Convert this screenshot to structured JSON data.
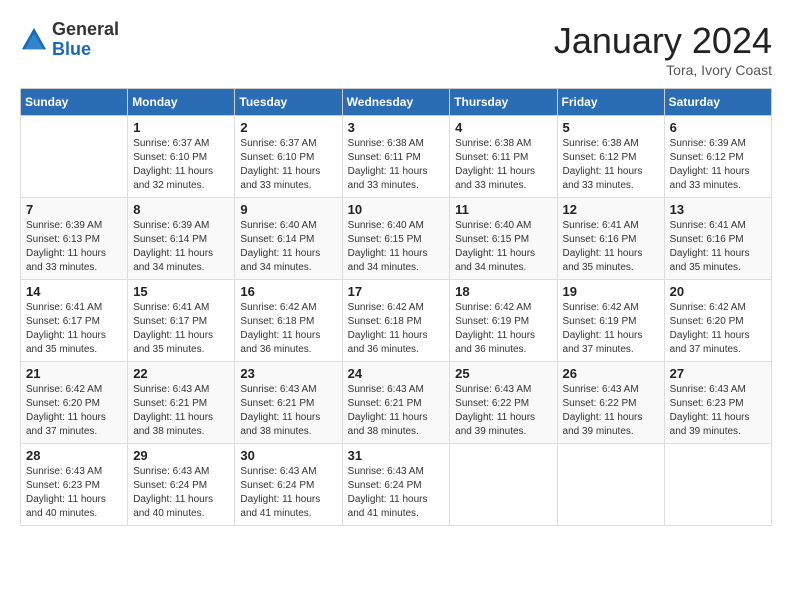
{
  "logo": {
    "general": "General",
    "blue": "Blue"
  },
  "title": "January 2024",
  "subtitle": "Tora, Ivory Coast",
  "days_header": [
    "Sunday",
    "Monday",
    "Tuesday",
    "Wednesday",
    "Thursday",
    "Friday",
    "Saturday"
  ],
  "weeks": [
    [
      {
        "day": "",
        "sunrise": "",
        "sunset": "",
        "daylight": ""
      },
      {
        "day": "1",
        "sunrise": "Sunrise: 6:37 AM",
        "sunset": "Sunset: 6:10 PM",
        "daylight": "Daylight: 11 hours and 32 minutes."
      },
      {
        "day": "2",
        "sunrise": "Sunrise: 6:37 AM",
        "sunset": "Sunset: 6:10 PM",
        "daylight": "Daylight: 11 hours and 33 minutes."
      },
      {
        "day": "3",
        "sunrise": "Sunrise: 6:38 AM",
        "sunset": "Sunset: 6:11 PM",
        "daylight": "Daylight: 11 hours and 33 minutes."
      },
      {
        "day": "4",
        "sunrise": "Sunrise: 6:38 AM",
        "sunset": "Sunset: 6:11 PM",
        "daylight": "Daylight: 11 hours and 33 minutes."
      },
      {
        "day": "5",
        "sunrise": "Sunrise: 6:38 AM",
        "sunset": "Sunset: 6:12 PM",
        "daylight": "Daylight: 11 hours and 33 minutes."
      },
      {
        "day": "6",
        "sunrise": "Sunrise: 6:39 AM",
        "sunset": "Sunset: 6:12 PM",
        "daylight": "Daylight: 11 hours and 33 minutes."
      }
    ],
    [
      {
        "day": "7",
        "sunrise": "Sunrise: 6:39 AM",
        "sunset": "Sunset: 6:13 PM",
        "daylight": "Daylight: 11 hours and 33 minutes."
      },
      {
        "day": "8",
        "sunrise": "Sunrise: 6:39 AM",
        "sunset": "Sunset: 6:14 PM",
        "daylight": "Daylight: 11 hours and 34 minutes."
      },
      {
        "day": "9",
        "sunrise": "Sunrise: 6:40 AM",
        "sunset": "Sunset: 6:14 PM",
        "daylight": "Daylight: 11 hours and 34 minutes."
      },
      {
        "day": "10",
        "sunrise": "Sunrise: 6:40 AM",
        "sunset": "Sunset: 6:15 PM",
        "daylight": "Daylight: 11 hours and 34 minutes."
      },
      {
        "day": "11",
        "sunrise": "Sunrise: 6:40 AM",
        "sunset": "Sunset: 6:15 PM",
        "daylight": "Daylight: 11 hours and 34 minutes."
      },
      {
        "day": "12",
        "sunrise": "Sunrise: 6:41 AM",
        "sunset": "Sunset: 6:16 PM",
        "daylight": "Daylight: 11 hours and 35 minutes."
      },
      {
        "day": "13",
        "sunrise": "Sunrise: 6:41 AM",
        "sunset": "Sunset: 6:16 PM",
        "daylight": "Daylight: 11 hours and 35 minutes."
      }
    ],
    [
      {
        "day": "14",
        "sunrise": "Sunrise: 6:41 AM",
        "sunset": "Sunset: 6:17 PM",
        "daylight": "Daylight: 11 hours and 35 minutes."
      },
      {
        "day": "15",
        "sunrise": "Sunrise: 6:41 AM",
        "sunset": "Sunset: 6:17 PM",
        "daylight": "Daylight: 11 hours and 35 minutes."
      },
      {
        "day": "16",
        "sunrise": "Sunrise: 6:42 AM",
        "sunset": "Sunset: 6:18 PM",
        "daylight": "Daylight: 11 hours and 36 minutes."
      },
      {
        "day": "17",
        "sunrise": "Sunrise: 6:42 AM",
        "sunset": "Sunset: 6:18 PM",
        "daylight": "Daylight: 11 hours and 36 minutes."
      },
      {
        "day": "18",
        "sunrise": "Sunrise: 6:42 AM",
        "sunset": "Sunset: 6:19 PM",
        "daylight": "Daylight: 11 hours and 36 minutes."
      },
      {
        "day": "19",
        "sunrise": "Sunrise: 6:42 AM",
        "sunset": "Sunset: 6:19 PM",
        "daylight": "Daylight: 11 hours and 37 minutes."
      },
      {
        "day": "20",
        "sunrise": "Sunrise: 6:42 AM",
        "sunset": "Sunset: 6:20 PM",
        "daylight": "Daylight: 11 hours and 37 minutes."
      }
    ],
    [
      {
        "day": "21",
        "sunrise": "Sunrise: 6:42 AM",
        "sunset": "Sunset: 6:20 PM",
        "daylight": "Daylight: 11 hours and 37 minutes."
      },
      {
        "day": "22",
        "sunrise": "Sunrise: 6:43 AM",
        "sunset": "Sunset: 6:21 PM",
        "daylight": "Daylight: 11 hours and 38 minutes."
      },
      {
        "day": "23",
        "sunrise": "Sunrise: 6:43 AM",
        "sunset": "Sunset: 6:21 PM",
        "daylight": "Daylight: 11 hours and 38 minutes."
      },
      {
        "day": "24",
        "sunrise": "Sunrise: 6:43 AM",
        "sunset": "Sunset: 6:21 PM",
        "daylight": "Daylight: 11 hours and 38 minutes."
      },
      {
        "day": "25",
        "sunrise": "Sunrise: 6:43 AM",
        "sunset": "Sunset: 6:22 PM",
        "daylight": "Daylight: 11 hours and 39 minutes."
      },
      {
        "day": "26",
        "sunrise": "Sunrise: 6:43 AM",
        "sunset": "Sunset: 6:22 PM",
        "daylight": "Daylight: 11 hours and 39 minutes."
      },
      {
        "day": "27",
        "sunrise": "Sunrise: 6:43 AM",
        "sunset": "Sunset: 6:23 PM",
        "daylight": "Daylight: 11 hours and 39 minutes."
      }
    ],
    [
      {
        "day": "28",
        "sunrise": "Sunrise: 6:43 AM",
        "sunset": "Sunset: 6:23 PM",
        "daylight": "Daylight: 11 hours and 40 minutes."
      },
      {
        "day": "29",
        "sunrise": "Sunrise: 6:43 AM",
        "sunset": "Sunset: 6:24 PM",
        "daylight": "Daylight: 11 hours and 40 minutes."
      },
      {
        "day": "30",
        "sunrise": "Sunrise: 6:43 AM",
        "sunset": "Sunset: 6:24 PM",
        "daylight": "Daylight: 11 hours and 41 minutes."
      },
      {
        "day": "31",
        "sunrise": "Sunrise: 6:43 AM",
        "sunset": "Sunset: 6:24 PM",
        "daylight": "Daylight: 11 hours and 41 minutes."
      },
      {
        "day": "",
        "sunrise": "",
        "sunset": "",
        "daylight": ""
      },
      {
        "day": "",
        "sunrise": "",
        "sunset": "",
        "daylight": ""
      },
      {
        "day": "",
        "sunrise": "",
        "sunset": "",
        "daylight": ""
      }
    ]
  ]
}
